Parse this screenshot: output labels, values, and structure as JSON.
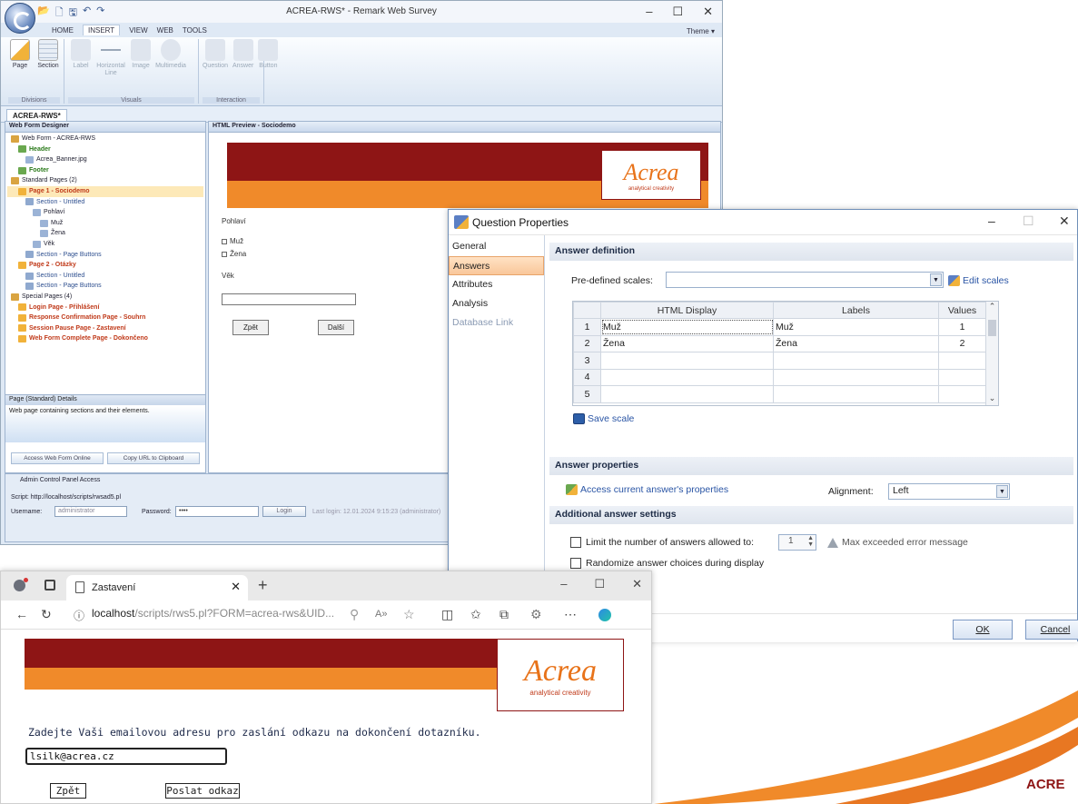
{
  "main_window": {
    "title": "ACREA-RWS* - Remark Web Survey",
    "ribbon_tabs": [
      "HOME",
      "INSERT",
      "VIEW",
      "WEB",
      "TOOLS"
    ],
    "theme": "Theme ▾",
    "groups": {
      "divisions": {
        "label": "Divisions",
        "buttons": [
          "Page",
          "Section"
        ]
      },
      "visuals": {
        "label": "Visuals",
        "buttons": [
          "Label",
          "Horizontal Line",
          "Image",
          "Multimedia"
        ]
      },
      "interaction": {
        "label": "Interaction",
        "buttons": [
          "Question",
          "Answer",
          "Button"
        ]
      }
    },
    "doc_tab": "ACREA-RWS*",
    "left_pane_title": "Web Form Designer",
    "tree": [
      {
        "label": "Web Form - ACREA-RWS",
        "style": "bold"
      },
      {
        "label": "Header",
        "style": "green"
      },
      {
        "label": "Acrea_Banner.jpg",
        "style": "plain"
      },
      {
        "label": "Footer",
        "style": "green"
      },
      {
        "label": "Standard Pages (2)",
        "style": "bold"
      },
      {
        "label": "Page 1 - Sociodemo",
        "style": "red"
      },
      {
        "label": "Section - Untitled",
        "style": "blue"
      },
      {
        "label": "Pohlaví",
        "style": "plain"
      },
      {
        "label": "Muž",
        "style": "plain"
      },
      {
        "label": "Žena",
        "style": "plain"
      },
      {
        "label": "Věk",
        "style": "plain"
      },
      {
        "label": "Section - Page Buttons",
        "style": "blue"
      },
      {
        "label": "Page 2 - Otázky",
        "style": "red"
      },
      {
        "label": "Section - Untitled",
        "style": "blue"
      },
      {
        "label": "Section - Page Buttons",
        "style": "blue"
      },
      {
        "label": "Special Pages (4)",
        "style": "bold"
      },
      {
        "label": "Login Page - Přihlášení",
        "style": "red"
      },
      {
        "label": "Response Confirmation Page - Souhrn",
        "style": "red"
      },
      {
        "label": "Session Pause Page - Zastavení",
        "style": "red"
      },
      {
        "label": "Web Form Complete Page - Dokončeno",
        "style": "red"
      }
    ],
    "details_title": "Page (Standard) Details",
    "details_text": "Web page containing sections and their elements.",
    "pane_buttons": [
      "Access Web Form Online",
      "Copy URL to Clipboard"
    ],
    "preview_title": "HTML Preview - Sociodemo",
    "preview": {
      "question": "Pohlaví",
      "options": [
        "Muž",
        "Žena"
      ],
      "age_label": "Věk",
      "back": "Zpět",
      "next": "Další"
    },
    "status": {
      "admin": "Admin Control Panel Access",
      "script": "Script: http://localhost/scripts/rwsad5.pl",
      "username_label": "Username:",
      "username_value": "administrator",
      "password_label": "Password:",
      "password_value": "••••",
      "login": "Login",
      "last_login": "Last login: 12.01.2024 9:15:23 (administrator)"
    }
  },
  "logo": {
    "word": "Acrea",
    "tagline": "analytical creativity"
  },
  "dialog": {
    "title": "Question Properties",
    "nav": [
      "General",
      "Answers",
      "Attributes",
      "Analysis",
      "Database Link"
    ],
    "answer_definition": "Answer definition",
    "predefined_label": "Pre-defined scales:",
    "edit_scales": "Edit scales",
    "grid": {
      "headers": [
        "HTML Display",
        "Labels",
        "Values"
      ],
      "rows": [
        {
          "n": "1",
          "html": "Muž",
          "label": "Muž",
          "value": "1"
        },
        {
          "n": "2",
          "html": "Žena",
          "label": "Žena",
          "value": "2"
        },
        {
          "n": "3",
          "html": "",
          "label": "",
          "value": ""
        },
        {
          "n": "4",
          "html": "",
          "label": "",
          "value": ""
        },
        {
          "n": "5",
          "html": "",
          "label": "",
          "value": ""
        }
      ]
    },
    "save_scale": "Save scale",
    "answer_properties": "Answer properties",
    "access_props": "Access current answer's properties",
    "alignment_label": "Alignment:",
    "alignment_value": "Left",
    "additional": "Additional answer settings",
    "limit_label": "Limit the number of answers allowed to:",
    "limit_value": "1",
    "max_exceeded": "Max exceeded error message",
    "randomize": "Randomize answer choices during display",
    "ok": "OK",
    "cancel": "Cancel"
  },
  "browser": {
    "tab_title": "Zastavení",
    "url_host": "localhost",
    "url_path": "/scripts/rws5.pl?FORM=acrea-rws&UID...",
    "prompt": "Zadejte Vaši emailovou adresu pro zaslání odkazu na dokončení dotazníku.",
    "email": "lsilk@acrea.cz",
    "back": "Zpět",
    "send": "Poslat odkaz"
  },
  "corner_text": "ACRE",
  "colors": {
    "brand_red": "#8e1515",
    "brand_orange": "#f08a2a",
    "accent_blue": "#2a55a5"
  }
}
